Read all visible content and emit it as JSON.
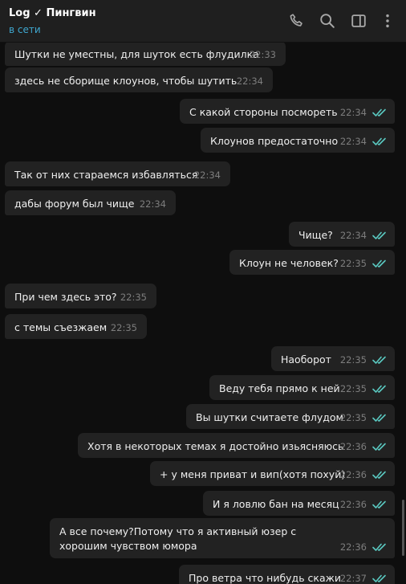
{
  "header": {
    "title": "Log ✓ Пингвин",
    "status": "в сети",
    "icons": [
      "phone-icon",
      "search-icon",
      "sidebar-toggle-icon",
      "more-icon"
    ]
  },
  "colors": {
    "background": "#0e0e0e",
    "bubble": "#222222",
    "status": "#3fa7cf",
    "read_ticks": "#5ac8c0"
  },
  "messages": [
    {
      "dir": "in",
      "text": "Шутки не уместны, для шуток есть флудилка",
      "time": "22:33"
    },
    {
      "dir": "in",
      "text": "здесь не сборище клоунов, чтобы шутить",
      "time": "22:34"
    },
    {
      "dir": "out",
      "text": "С какой стороны посмореть",
      "time": "22:34"
    },
    {
      "dir": "out",
      "text": "Клоунов предостаточно",
      "time": "22:34"
    },
    {
      "dir": "in",
      "text": "Так от них стараемся избавляться",
      "time": "22:34"
    },
    {
      "dir": "in",
      "text": "дабы форум был чище",
      "time": "22:34"
    },
    {
      "dir": "out",
      "text": "Чище?",
      "time": "22:34"
    },
    {
      "dir": "out",
      "text": "Клоун не человек?",
      "time": "22:35"
    },
    {
      "dir": "in",
      "text": "При чем здесь это?",
      "time": "22:35"
    },
    {
      "dir": "in",
      "text": "с темы съезжаем",
      "time": "22:35"
    },
    {
      "dir": "out",
      "text": "Наоборот",
      "time": "22:35"
    },
    {
      "dir": "out",
      "text": "Веду тебя прямо к ней",
      "time": "22:35"
    },
    {
      "dir": "out",
      "text": "Вы шутки считаете флудом",
      "time": "22:35"
    },
    {
      "dir": "out",
      "text": "Хотя в некоторых темах  я достойно изьясняюсь",
      "time": "22:36"
    },
    {
      "dir": "out",
      "text": "+ у меня приват и вип(хотя похуй)",
      "time": "22:36"
    },
    {
      "dir": "out",
      "text": "И я ловлю бан на месяц",
      "time": "22:36"
    },
    {
      "dir": "out",
      "text": "А все почему?Потому что я активный юзер с хорошим чувством юмора",
      "time": "22:36"
    },
    {
      "dir": "out",
      "text": "Про ветра что нибудь скажи",
      "time": "22:37"
    }
  ]
}
